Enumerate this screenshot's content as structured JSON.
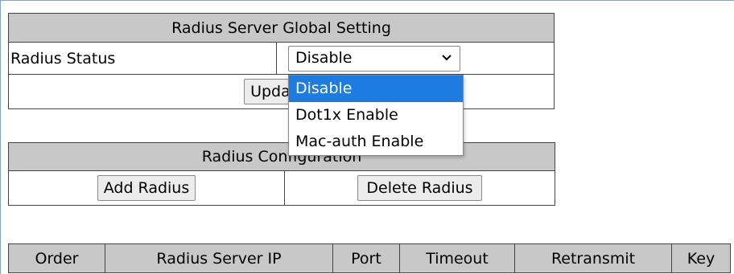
{
  "global": {
    "title": "Radius Server Global Setting",
    "status_label": "Radius Status",
    "status_value": "Disable",
    "options": [
      "Disable",
      "Dot1x Enable",
      "Mac-auth Enable"
    ],
    "update_label": "Update"
  },
  "config": {
    "title": "Radius Configuration",
    "add_label": "Add Radius",
    "delete_label": "Delete Radius"
  },
  "server_table": {
    "columns": [
      "Order",
      "Radius Server IP",
      "Port",
      "Timeout",
      "Retransmit",
      "Key"
    ]
  },
  "colors": {
    "header_bg": "#c8c8c8",
    "selected_option_bg": "#1e7be0",
    "frame_border": "#7fa6c9"
  },
  "icons": {
    "select_arrow": "chevron-down-icon"
  }
}
